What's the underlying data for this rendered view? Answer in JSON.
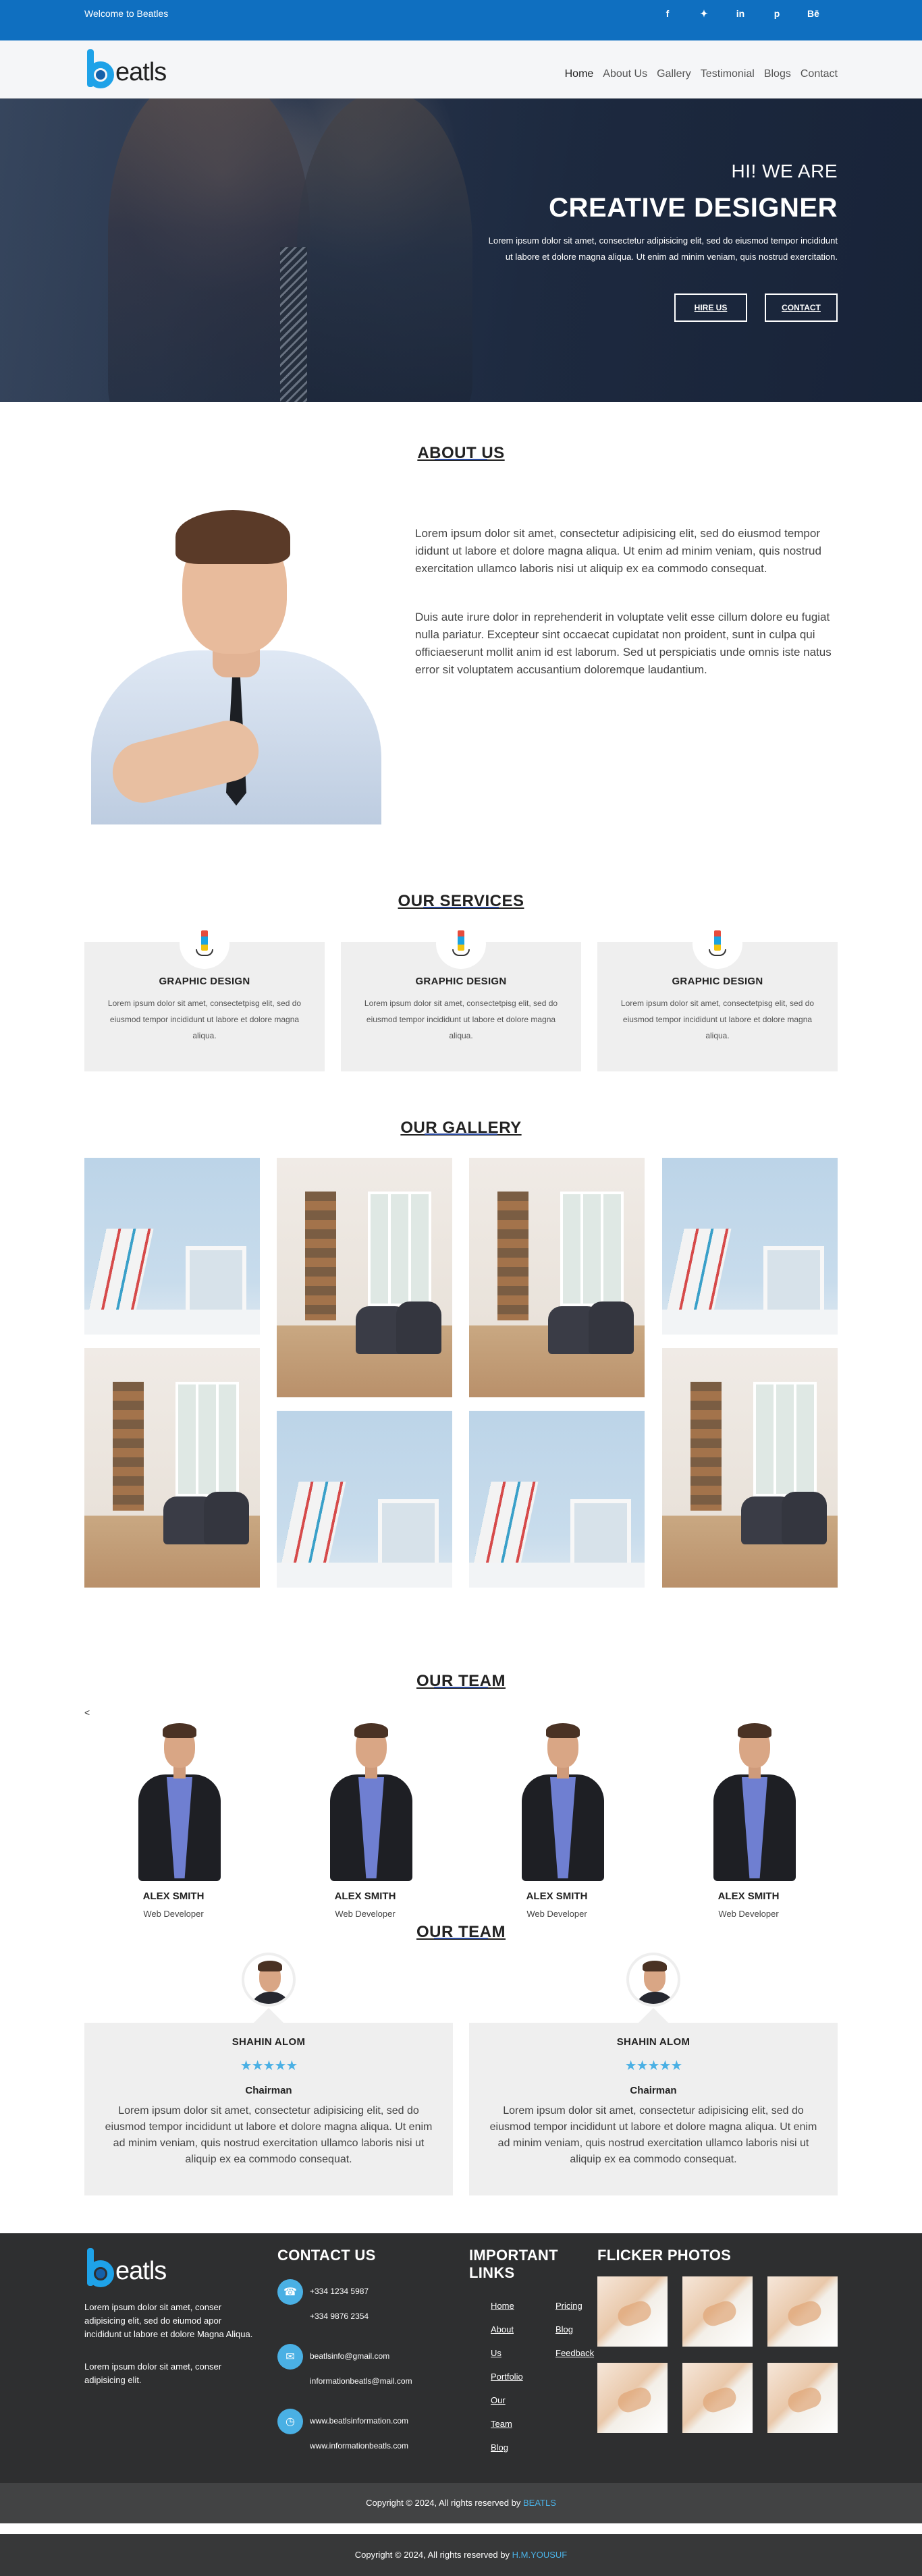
{
  "topbar": {
    "welcome": "Welcome to Beatles",
    "socials": [
      {
        "icon": "facebook-icon",
        "glyph": "f"
      },
      {
        "icon": "twitter-icon",
        "glyph": "t"
      },
      {
        "icon": "linkedin-icon",
        "glyph": "in"
      },
      {
        "icon": "pinterest-icon",
        "glyph": "p"
      },
      {
        "icon": "behance-icon",
        "glyph": "Bē"
      }
    ]
  },
  "brand": {
    "logo_text": "eatls",
    "accent": "#1ea2e8",
    "topbar_color": "#0f6fc0"
  },
  "nav": {
    "items": [
      "Home",
      "About Us",
      "Gallery",
      "Testimonial",
      "Blogs",
      "Contact"
    ],
    "active": "Home"
  },
  "hero": {
    "greeting": "HI! WE ARE",
    "title": "CREATIVE DESIGNER",
    "description": "Lorem ipsum dolor sit amet, consectetur adipisicing elit, sed do eiusmod tempor incididunt ut labore et dolore magna aliqua. Ut enim ad minim veniam, quis nostrud exercitation.",
    "btn_hire": "HIRE US",
    "btn_contact": "CONTACT"
  },
  "about": {
    "title": "ABOUT US",
    "p1": "Lorem ipsum dolor sit amet, consectetur adipisicing elit, sed do eiusmod tempor ididunt ut labore et dolore magna aliqua. Ut enim ad minim veniam, quis nostrud exercitation ullamco laboris nisi ut aliquip ex ea commodo consequat.",
    "p2": "Duis aute irure dolor in reprehenderit in voluptate velit esse cillum dolore eu fugiat nulla pariatur. Excepteur sint occaecat cupidatat non proident, sunt in culpa qui officiaeserunt mollit anim id est laborum. Sed ut perspiciatis unde omnis iste natus error sit voluptatem accusantium doloremque laudantium."
  },
  "services": {
    "title": "OUR SERVICES",
    "items": [
      {
        "name": "GRAPHIC DESIGN",
        "text": "Lorem ipsum dolor sit amet, consectetpisg elit, sed do eiusmod tempor incididunt ut labore et dolore magna aliqua."
      },
      {
        "name": "GRAPHIC DESIGN",
        "text": "Lorem ipsum dolor sit amet, consectetpisg elit, sed do eiusmod tempor incididunt ut labore et dolore magna aliqua."
      },
      {
        "name": "GRAPHIC DESIGN",
        "text": "Lorem ipsum dolor sit amet, consectetpisg elit, sed do eiusmod tempor incididunt ut labore et dolore magna aliqua."
      }
    ]
  },
  "gallery": {
    "title": "OUR GALLERY"
  },
  "team": {
    "title": "OUR TEAM",
    "prev": "<",
    "members": [
      {
        "name": "ALEX SMITH",
        "role": "Web Developer"
      },
      {
        "name": "ALEX SMITH",
        "role": "Web Developer"
      },
      {
        "name": "ALEX SMITH",
        "role": "Web Developer"
      },
      {
        "name": "ALEX SMITH",
        "role": "Web Developer"
      }
    ]
  },
  "testimonials": {
    "title": "OUR TEAM",
    "items": [
      {
        "name": "SHAHIN ALOM",
        "stars": "★★★★★",
        "role": "Chairman",
        "text": "Lorem ipsum dolor sit amet, consectetur adipisicing elit, sed do eiusmod tempor incididunt ut labore et dolore magna aliqua. Ut enim ad minim veniam, quis nostrud exercitation ullamco laboris nisi ut aliquip ex ea commodo consequat."
      },
      {
        "name": "SHAHIN ALOM",
        "stars": "★★★★★",
        "role": "Chairman",
        "text": "Lorem ipsum dolor sit amet, consectetur adipisicing elit, sed do eiusmod tempor incididunt ut labore et dolore magna aliqua. Ut enim ad minim veniam, quis nostrud exercitation ullamco laboris nisi ut aliquip ex ea commodo consequat."
      }
    ]
  },
  "footer": {
    "about1": "Lorem ipsum dolor sit amet, conser adipisicing elit, sed do eiumod apor incididunt ut labore et dolore Magna Aliqua.",
    "about2": "Lorem ipsum dolor sit amet, conser adipisicing elit.",
    "contact_title": "CONTACT US",
    "phone1": "+334 1234 5987",
    "phone2": "+334 9876 2354",
    "email1": "beatlsinfo@gmail.com",
    "email2": "informationbeatls@mail.com",
    "web1": "www.beatlsinformation.com",
    "web2": "www.informationbeatls.com",
    "links_title": "IMPORTANT LINKS",
    "links_col1": [
      "Home",
      "About",
      "Us",
      "Portfolio",
      "Our",
      "Team",
      "Blog"
    ],
    "links_col2": [
      "Pricing",
      "Blog",
      "Feedback"
    ],
    "photos_title": "FLICKER PHOTOS",
    "copyright1_prefix": "Copyright © 2024, All rights reserved by",
    "copyright1_link": "BEATLS",
    "copyright2_prefix": "Copyright © 2024, All rights reserved by",
    "copyright2_link": "H.M.YOUSUF"
  }
}
